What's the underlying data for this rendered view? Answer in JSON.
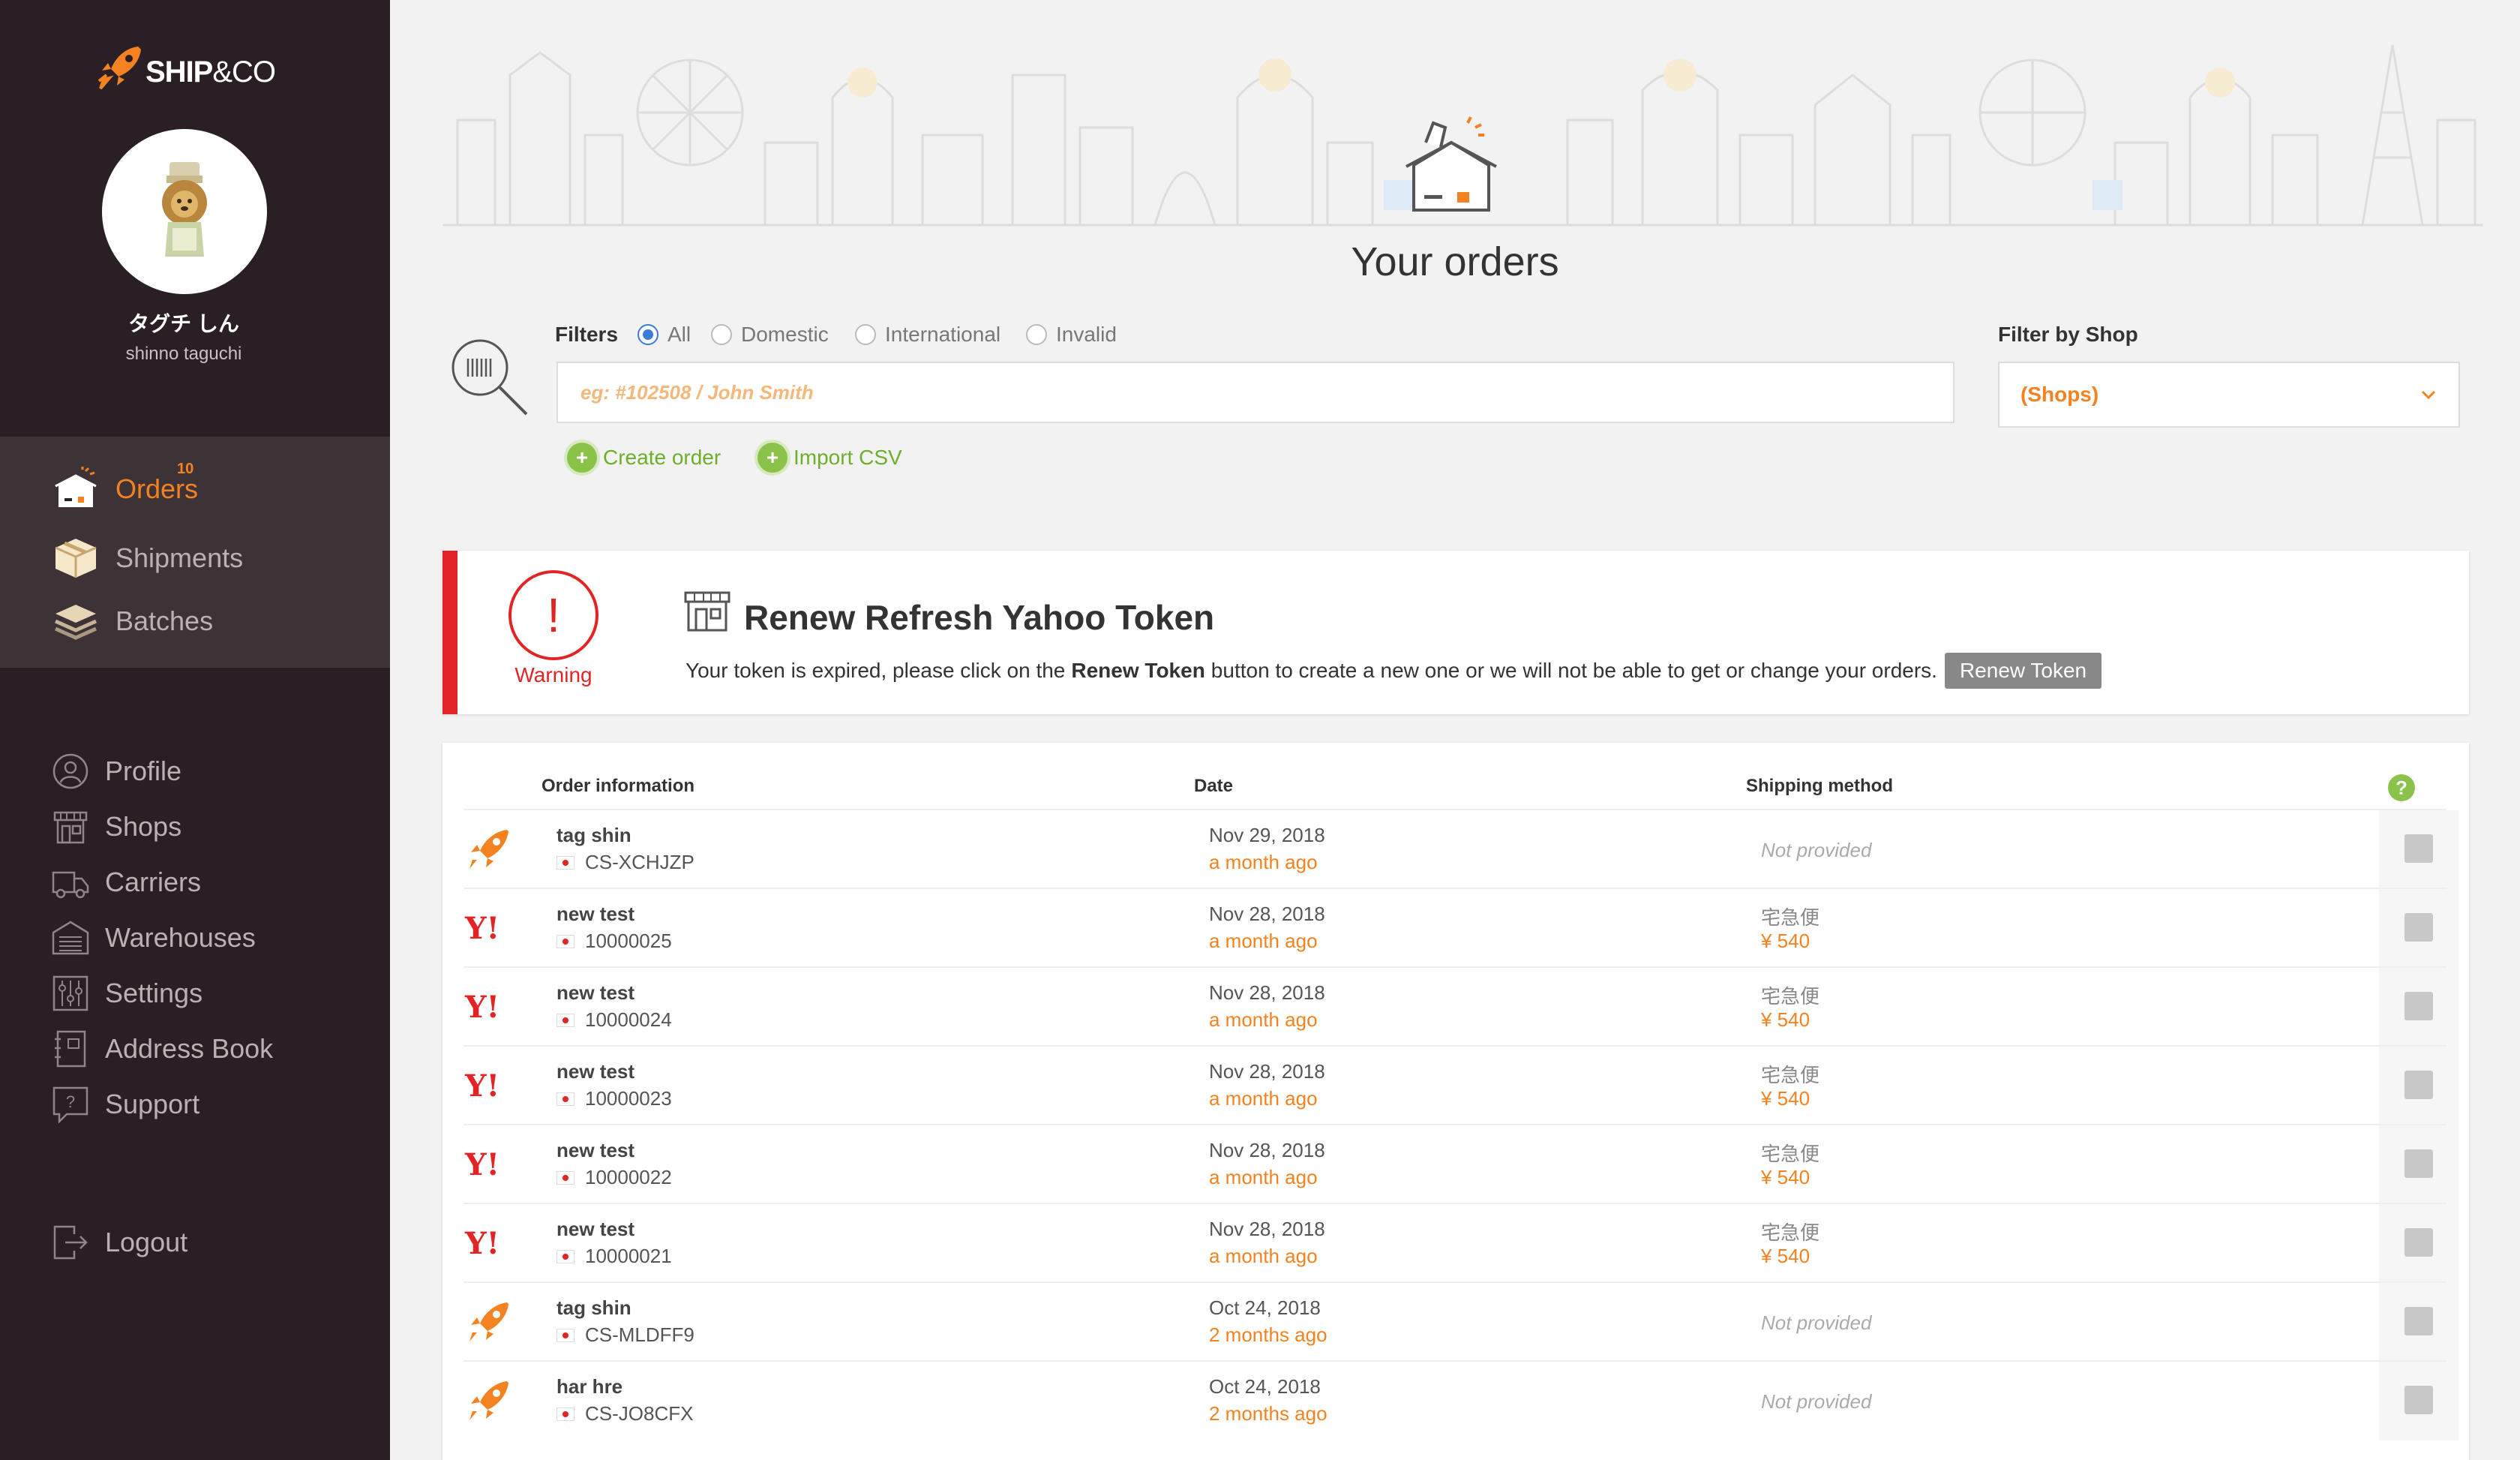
{
  "app": {
    "brand_main": "SHIP",
    "brand_suffix": "&CO",
    "accent_color": "#f58220"
  },
  "user": {
    "display_name": "タグチ しん",
    "username": "shinno taguchi"
  },
  "nav": {
    "orders": {
      "label": "Orders",
      "badge": "10",
      "icon": "orders-box-icon"
    },
    "shipments": {
      "label": "Shipments",
      "icon": "package-icon"
    },
    "batches": {
      "label": "Batches",
      "icon": "stack-icon"
    }
  },
  "secondary_nav": [
    {
      "label": "Profile",
      "icon": "user-icon"
    },
    {
      "label": "Shops",
      "icon": "shop-icon"
    },
    {
      "label": "Carriers",
      "icon": "truck-icon"
    },
    {
      "label": "Warehouses",
      "icon": "warehouse-icon"
    },
    {
      "label": "Settings",
      "icon": "sliders-icon"
    },
    {
      "label": "Address Book",
      "icon": "address-book-icon"
    },
    {
      "label": "Support",
      "icon": "support-icon"
    }
  ],
  "logout": {
    "label": "Logout",
    "icon": "logout-icon"
  },
  "page": {
    "title": "Your orders"
  },
  "filters": {
    "label": "Filters",
    "options": [
      "All",
      "Domestic",
      "International",
      "Invalid"
    ],
    "selected": "All",
    "search_placeholder": "eg: #102508 / John Smith"
  },
  "shop_filter": {
    "label": "Filter by Shop",
    "value": "(Shops)"
  },
  "actions": {
    "create": "Create order",
    "import": "Import CSV"
  },
  "warning": {
    "label": "Warning",
    "title": "Renew Refresh Yahoo Token",
    "text_before": "Your token is expired, please click on the",
    "text_bold": "Renew Token",
    "text_after": "button to create a new one or we will not be able to get or change your orders.",
    "button": "Renew Token"
  },
  "table": {
    "headers": {
      "order": "Order information",
      "date": "Date",
      "shipping": "Shipping method"
    },
    "rows": [
      {
        "source": "shipandco",
        "name": "tag shin",
        "order_id": "CS-XCHJZP",
        "date": "Nov 29, 2018",
        "ago": "a month ago",
        "shipping": "Not provided",
        "price": ""
      },
      {
        "source": "yahoo",
        "name": "new test",
        "order_id": "10000025",
        "date": "Nov 28, 2018",
        "ago": "a month ago",
        "shipping": "宅急便",
        "price": "¥ 540"
      },
      {
        "source": "yahoo",
        "name": "new test",
        "order_id": "10000024",
        "date": "Nov 28, 2018",
        "ago": "a month ago",
        "shipping": "宅急便",
        "price": "¥ 540"
      },
      {
        "source": "yahoo",
        "name": "new test",
        "order_id": "10000023",
        "date": "Nov 28, 2018",
        "ago": "a month ago",
        "shipping": "宅急便",
        "price": "¥ 540"
      },
      {
        "source": "yahoo",
        "name": "new test",
        "order_id": "10000022",
        "date": "Nov 28, 2018",
        "ago": "a month ago",
        "shipping": "宅急便",
        "price": "¥ 540"
      },
      {
        "source": "yahoo",
        "name": "new test",
        "order_id": "10000021",
        "date": "Nov 28, 2018",
        "ago": "a month ago",
        "shipping": "宅急便",
        "price": "¥ 540"
      },
      {
        "source": "shipandco",
        "name": "tag shin",
        "order_id": "CS-MLDFF9",
        "date": "Oct 24, 2018",
        "ago": "2 months ago",
        "shipping": "Not provided",
        "price": ""
      },
      {
        "source": "shipandco",
        "name": "har hre",
        "order_id": "CS-JO8CFX",
        "date": "Oct 24, 2018",
        "ago": "2 months ago",
        "shipping": "Not provided",
        "price": ""
      }
    ]
  }
}
